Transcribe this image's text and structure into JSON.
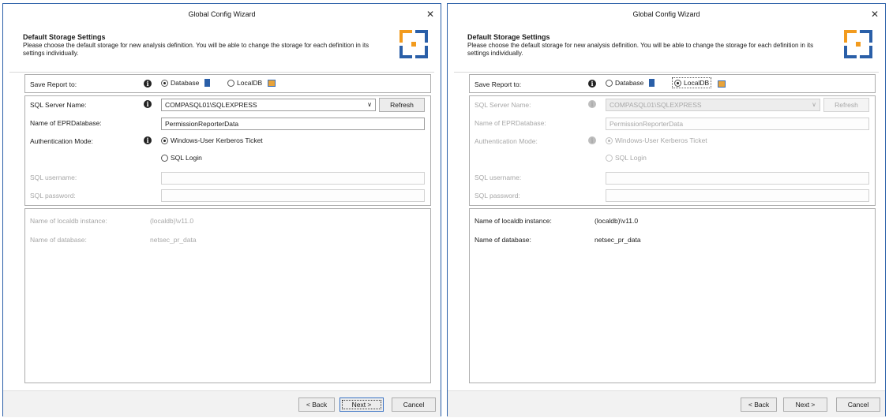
{
  "window_title": "Global Config Wizard",
  "close_glyph": "✕",
  "header": {
    "title": "Default Storage Settings",
    "description": "Please choose the default storage for new analysis definition. You will be able to change the storage for each definition in its settings individually."
  },
  "labels": {
    "save_report_to": "Save Report to:",
    "sql_server_name": "SQL Server Name:",
    "epr_database": "Name of EPRDatabase:",
    "auth_mode": "Authentication Mode:",
    "sql_username": "SQL username:",
    "sql_password": "SQL password:",
    "localdb_instance": "Name of localdb instance:",
    "database_name": "Name of database:"
  },
  "options": {
    "database": "Database",
    "localdb": "LocalDB",
    "windows_auth": "Windows-User Kerberos Ticket",
    "sql_login": "SQL Login"
  },
  "values": {
    "sql_server": "COMPASQL01\\SQLEXPRESS",
    "epr_database": "PermissionReporterData",
    "localdb_instance": "(localdb)\\v11.0",
    "database_name": "netsec_pr_data"
  },
  "buttons": {
    "refresh": "Refresh",
    "back": "< Back",
    "next": "Next >",
    "cancel": "Cancel"
  },
  "icons": [
    "info-icon",
    "database-icon",
    "localdb-icon",
    "wizard-logo-icon",
    "close-icon",
    "chevron-down-icon"
  ],
  "colors": {
    "accent_orange": "#f29b1e",
    "accent_blue": "#2a5fa8",
    "disabled_text": "#a7a7a7"
  }
}
